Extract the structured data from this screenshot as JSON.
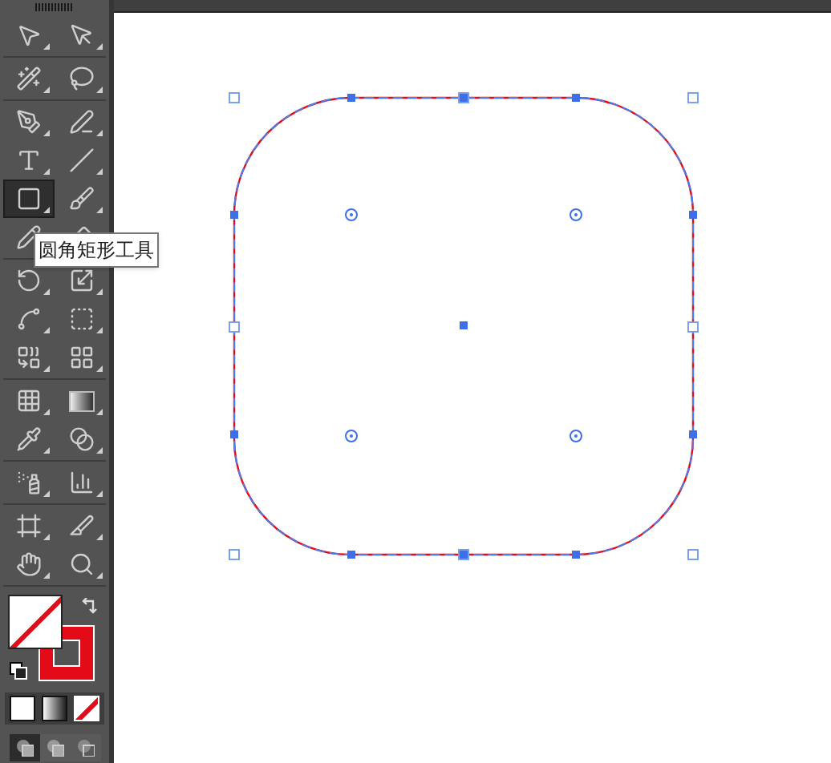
{
  "tool_groups": [
    {
      "tools": [
        {
          "kind": "selection",
          "selected": false
        },
        {
          "kind": "direct-selection",
          "selected": false
        }
      ]
    },
    {
      "tools": [
        {
          "kind": "magic-wand",
          "selected": false
        },
        {
          "kind": "lasso",
          "selected": false
        }
      ]
    },
    {
      "tools": [
        {
          "kind": "pen",
          "selected": false
        },
        {
          "kind": "curvature",
          "selected": false
        },
        {
          "kind": "type",
          "selected": false
        },
        {
          "kind": "line",
          "selected": false
        },
        {
          "kind": "rounded-rectangle",
          "selected": true
        },
        {
          "kind": "paintbrush",
          "selected": false
        },
        {
          "kind": "pencil",
          "selected": false
        },
        {
          "kind": "eraser",
          "selected": false
        }
      ]
    },
    {
      "tools": [
        {
          "kind": "rotate",
          "selected": false
        },
        {
          "kind": "scale",
          "selected": false
        },
        {
          "kind": "puppet-warp",
          "selected": false
        },
        {
          "kind": "free-transform",
          "selected": false
        },
        {
          "kind": "shape-builder",
          "selected": false
        },
        {
          "kind": "perspective-grid",
          "selected": false
        }
      ]
    },
    {
      "tools": [
        {
          "kind": "mesh",
          "selected": false
        },
        {
          "kind": "gradient",
          "selected": false
        },
        {
          "kind": "eyedropper",
          "selected": false
        },
        {
          "kind": "blend",
          "selected": false
        }
      ]
    },
    {
      "tools": [
        {
          "kind": "symbol-sprayer",
          "selected": false
        },
        {
          "kind": "column-graph",
          "selected": false
        }
      ]
    },
    {
      "tools": [
        {
          "kind": "artboard",
          "selected": false
        },
        {
          "kind": "slice",
          "selected": false
        },
        {
          "kind": "hand",
          "selected": false
        },
        {
          "kind": "zoom",
          "selected": false
        }
      ]
    }
  ],
  "tooltip": {
    "text": "圆角矩形工具"
  },
  "fill": {
    "kind": "none"
  },
  "stroke": {
    "kind": "color",
    "color": "#e30b17"
  },
  "color_modes": [
    {
      "kind": "color",
      "selected": false
    },
    {
      "kind": "gradient",
      "selected": false
    },
    {
      "kind": "none",
      "selected": true
    }
  ],
  "draw_modes": [
    {
      "kind": "normal",
      "selected": true
    },
    {
      "kind": "behind",
      "selected": false
    },
    {
      "kind": "inside",
      "selected": false
    }
  ]
}
